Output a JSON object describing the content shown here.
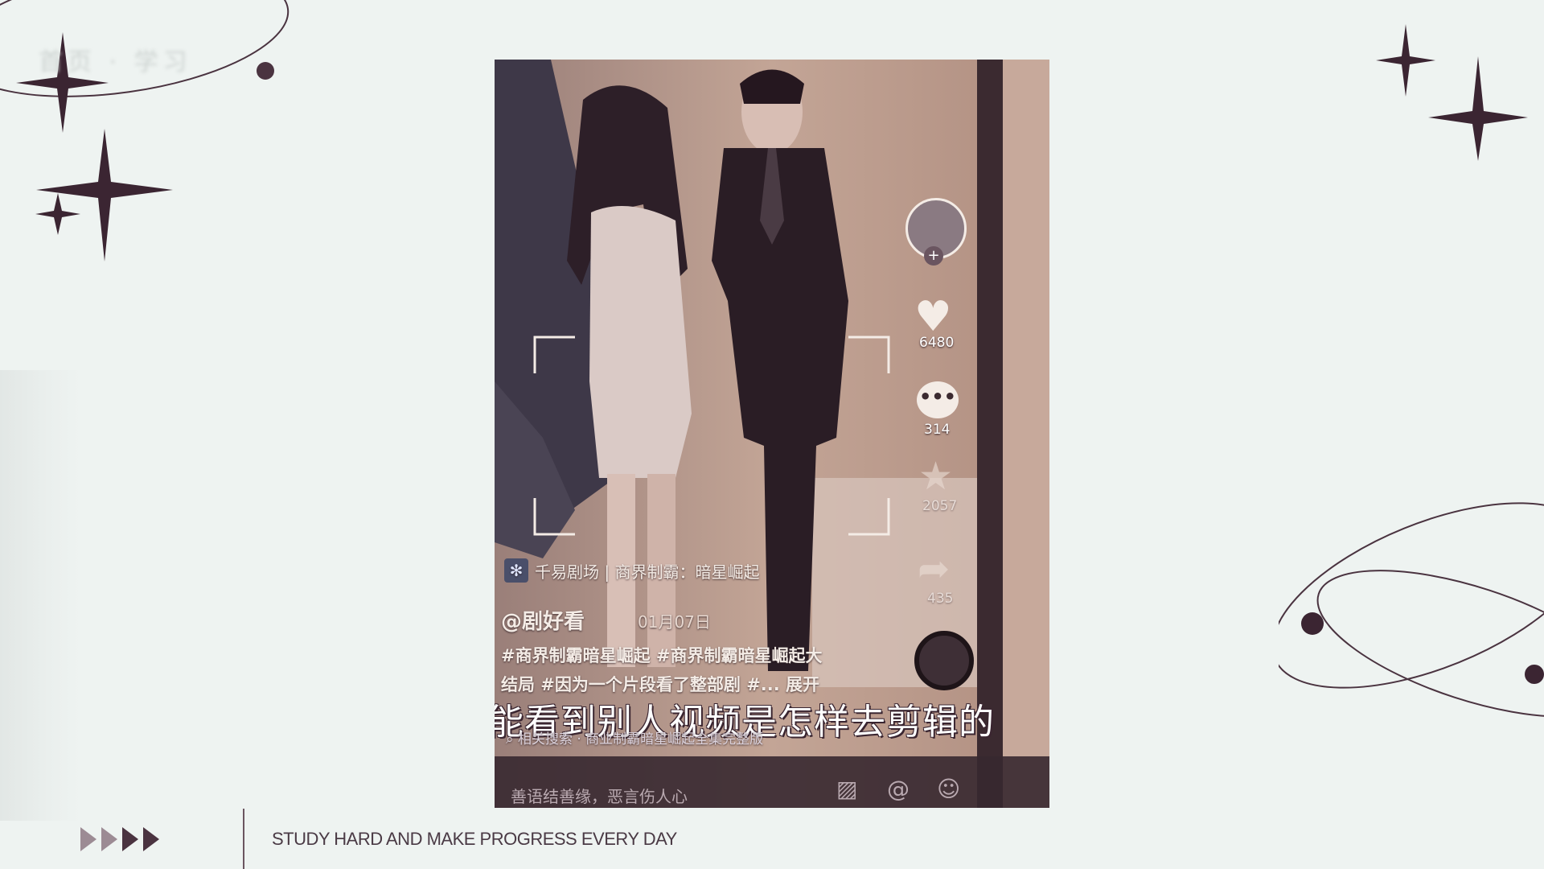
{
  "slide": {
    "background": "#eef3f1",
    "motto": "STUDY HARD AND MAKE PROGRESS EVERY DAY"
  },
  "video": {
    "drama_badge": "千易剧场 | 商界制霸：暗星崛起",
    "author": "@剧好看",
    "date": "01月07日",
    "tags_line1": "#商界制霸暗星崛起 #商界制霸暗星崛起大",
    "tags_line2": "结局 #因为一个片段看了整部剧 #...  展开",
    "subtitle": "能看到别人视频是怎样去剪辑的",
    "search_hint": "相关搜索 · 商业制霸暗星崛起全集完整版",
    "comment_placeholder": "善语结善缘，恶言伤人心"
  },
  "rail": {
    "likes": "6480",
    "comments": "314",
    "favorites": "2057",
    "shares": "435"
  },
  "colors": {
    "accent_dark": "#4a3340",
    "phone_tone": "#b99c8f"
  }
}
